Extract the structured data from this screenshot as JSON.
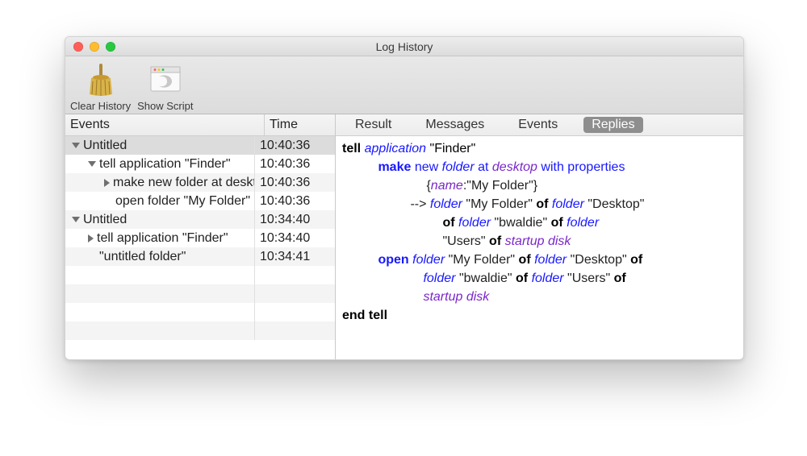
{
  "window": {
    "title": "Log History"
  },
  "toolbar": {
    "clear_label": "Clear History",
    "show_label": "Show Script"
  },
  "columns": {
    "events": "Events",
    "time": "Time"
  },
  "rows": [
    {
      "indent": 8,
      "tri": "down",
      "label": "Untitled",
      "time": "10:40:36",
      "selected": true
    },
    {
      "indent": 28,
      "tri": "down",
      "label": "tell application \"Finder\"",
      "time": "10:40:36"
    },
    {
      "indent": 48,
      "tri": "right",
      "label": "make new folder at desktop",
      "time": "10:40:36"
    },
    {
      "indent": 62,
      "tri": "",
      "label": "open folder \"My Folder\"",
      "time": "10:40:36"
    },
    {
      "indent": 8,
      "tri": "down",
      "label": "Untitled",
      "time": "10:34:40"
    },
    {
      "indent": 28,
      "tri": "right",
      "label": "tell application \"Finder\"",
      "time": "10:34:40"
    },
    {
      "indent": 42,
      "tri": "",
      "label": "\"untitled folder\"",
      "time": "10:34:41"
    },
    {
      "indent": 0,
      "tri": "",
      "label": "",
      "time": ""
    },
    {
      "indent": 0,
      "tri": "",
      "label": "",
      "time": ""
    },
    {
      "indent": 0,
      "tri": "",
      "label": "",
      "time": ""
    },
    {
      "indent": 0,
      "tri": "",
      "label": "",
      "time": ""
    }
  ],
  "tabs": {
    "result": "Result",
    "messages": "Messages",
    "events": "Events",
    "replies": "Replies"
  },
  "script": {
    "l1": {
      "tell": "tell",
      "application": "application",
      "finder": " \"Finder\""
    },
    "l2": {
      "make": "make",
      "new": " new ",
      "folder": "folder",
      "at": " at ",
      "desktop": "desktop",
      "with": " with properties"
    },
    "l3": {
      "brace_open": "{",
      "name": "name",
      "colon_my": ":\"My Folder\"}"
    },
    "l4": {
      "arrow": "--> ",
      "folder1": "folder",
      "my": " \"My Folder\" ",
      "of1": "of",
      "folder2": " folder",
      "desktop": " \"Desktop\""
    },
    "l5": {
      "of1": "of",
      "folder1": " folder",
      "bw": " \"bwaldie\" ",
      "of2": "of",
      "folder2": " folder"
    },
    "l6": {
      "users": "\"Users\" ",
      "of": "of",
      "sd": " startup disk"
    },
    "l7": {
      "open": "open",
      "folder1": " folder",
      "my": " \"My Folder\" ",
      "of1": "of",
      "folder2": " folder",
      "desk": " \"Desktop\" ",
      "of2": "of"
    },
    "l8": {
      "folder1": "folder",
      "bw": " \"bwaldie\" ",
      "of1": "of",
      "folder2": " folder",
      "users": " \"Users\" ",
      "of2": "of"
    },
    "l9": {
      "sd": "startup disk"
    },
    "l10": {
      "end": "end tell"
    }
  }
}
